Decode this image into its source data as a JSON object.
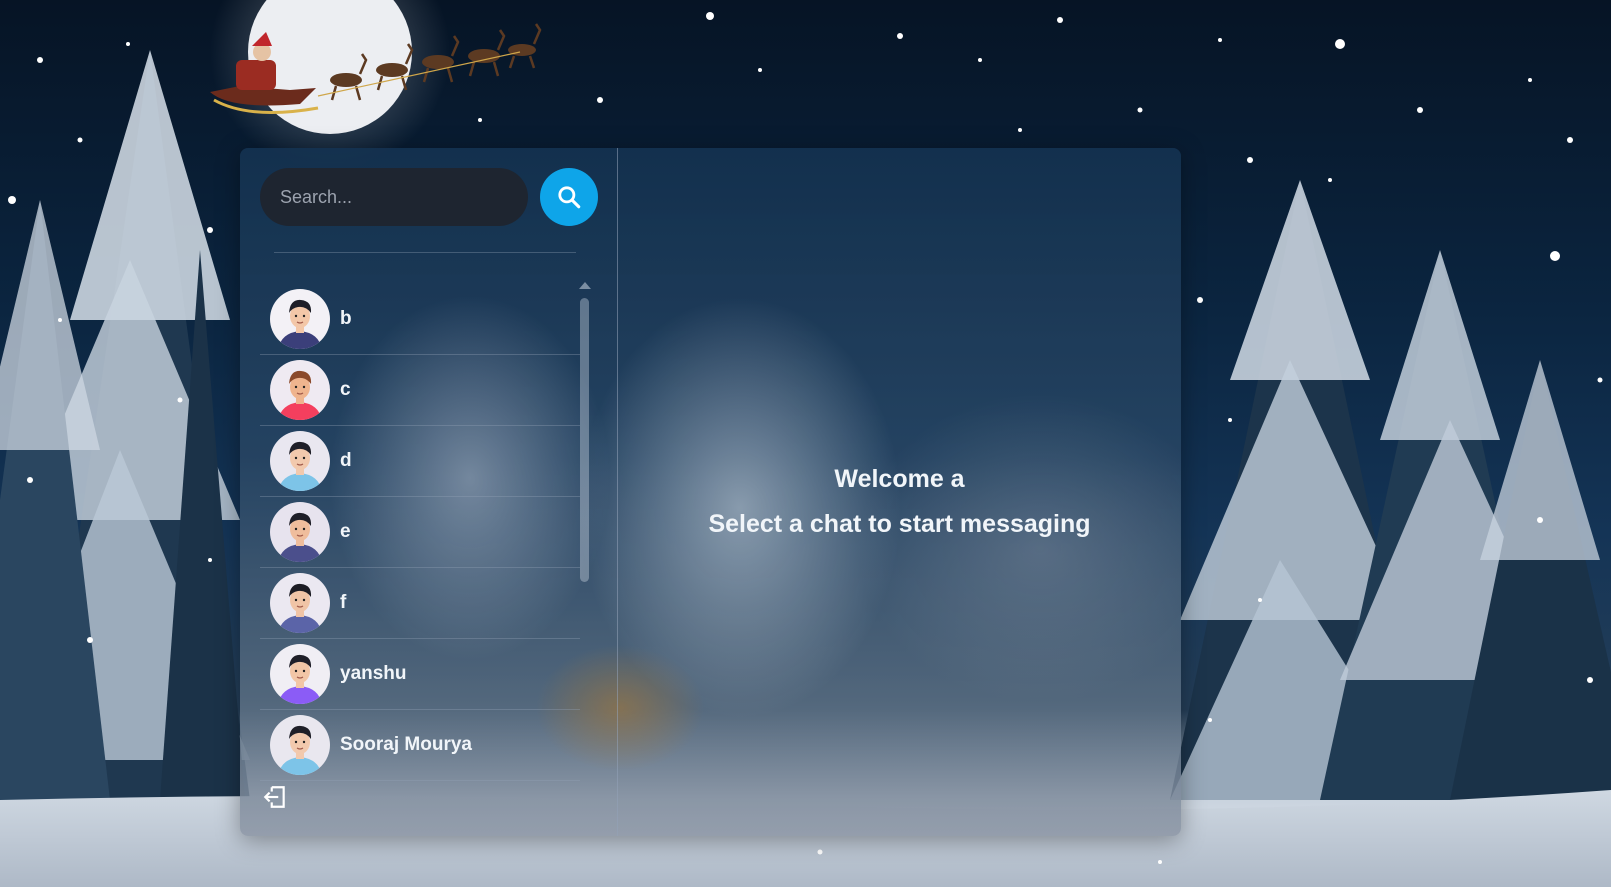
{
  "search": {
    "placeholder": "Search...",
    "button_icon": "search-icon"
  },
  "conversations": [
    {
      "name": "b",
      "avatar_bg": "#f3f1f6",
      "shirt": "#3b3f7a",
      "hair": "#1f1f28",
      "skin": "#f3c7a8"
    },
    {
      "name": "c",
      "avatar_bg": "#efeaf2",
      "shirt": "#f43f5e",
      "hair": "#8b4a2b",
      "skin": "#efb48e"
    },
    {
      "name": "d",
      "avatar_bg": "#e9e7f0",
      "shirt": "#7dc4e8",
      "hair": "#1f1f28",
      "skin": "#f2c9ad"
    },
    {
      "name": "e",
      "avatar_bg": "#e7e3ee",
      "shirt": "#4b4f8c",
      "hair": "#1f1f28",
      "skin": "#efbd9c"
    },
    {
      "name": "f",
      "avatar_bg": "#ebe8f1",
      "shirt": "#5b64a8",
      "hair": "#1c1c24",
      "skin": "#f0c4a6"
    },
    {
      "name": "yanshu",
      "avatar_bg": "#f0eef4",
      "shirt": "#8b5cf6",
      "hair": "#1f1f28",
      "skin": "#f2c6a6"
    },
    {
      "name": "Sooraj Mourya",
      "avatar_bg": "#e9e7ef",
      "shirt": "#7dc4e8",
      "hair": "#1f1f28",
      "skin": "#f2c9ad"
    }
  ],
  "logout_icon": "logout-icon",
  "welcome": {
    "line1": "Welcome a",
    "line2": "Select a chat to start messaging"
  },
  "colors": {
    "accent": "#0ea5e9",
    "input_bg": "#1e2530",
    "text": "#f1f5f9"
  }
}
